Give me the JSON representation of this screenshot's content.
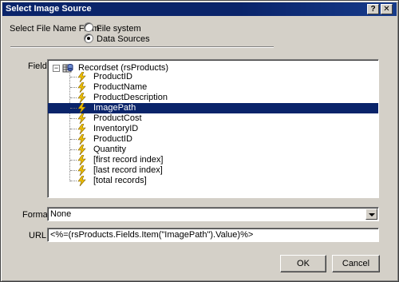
{
  "window": {
    "title": "Select Image Source",
    "help_icon": "question-mark-icon",
    "close_icon": "close-icon"
  },
  "source": {
    "label": "Select File Name From:",
    "options": [
      {
        "label": "File system",
        "selected": false
      },
      {
        "label": "Data Sources",
        "selected": true
      }
    ]
  },
  "field": {
    "label": "Field:",
    "root": "Recordset (rsProducts)",
    "items": [
      {
        "label": "ProductID",
        "selected": false
      },
      {
        "label": "ProductName",
        "selected": false
      },
      {
        "label": "ProductDescription",
        "selected": false
      },
      {
        "label": "ImagePath",
        "selected": true
      },
      {
        "label": "ProductCost",
        "selected": false
      },
      {
        "label": "InventoryID",
        "selected": false
      },
      {
        "label": "ProductID",
        "selected": false
      },
      {
        "label": "Quantity",
        "selected": false
      },
      {
        "label": "[first record index]",
        "selected": false
      },
      {
        "label": "[last record index]",
        "selected": false
      },
      {
        "label": "[total records]",
        "selected": false
      }
    ]
  },
  "format": {
    "label": "Format:",
    "value": "None"
  },
  "url": {
    "label": "URL:",
    "value": "<%=(rsProducts.Fields.Item(\"ImagePath\").Value)%>"
  },
  "buttons": {
    "ok": "OK",
    "cancel": "Cancel"
  },
  "colors": {
    "titlebar": "#0a246a",
    "selection": "#0a246a",
    "face": "#d4d0c8",
    "bolt": "#f0c000"
  }
}
